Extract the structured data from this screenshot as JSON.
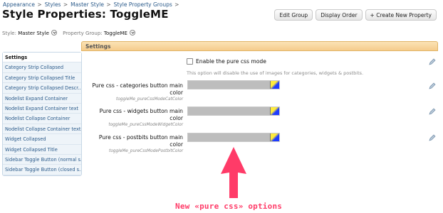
{
  "breadcrumb": [
    "Appearance",
    "Styles",
    "Master Style",
    "Style Property Groups"
  ],
  "page_title": "Style Properties: ToggleME",
  "buttons": {
    "edit_group": "Edit Group",
    "display_order": "Display Order",
    "create": "+ Create New Property"
  },
  "filters": {
    "style_label": "Style:",
    "style_value": "Master Style",
    "group_label": "Property Group:",
    "group_value": "ToggleME"
  },
  "sidebar": {
    "items": [
      {
        "label": "Settings"
      },
      {
        "label": "Category Strip Collapsed"
      },
      {
        "label": "Category Strip Collapsed Title"
      },
      {
        "label": "Category Strip Collapsed Descr..."
      },
      {
        "label": "Nodelist Expand Container"
      },
      {
        "label": "Nodelist Expand Container text"
      },
      {
        "label": "Nodelist Collapse Container"
      },
      {
        "label": "Nodelist Collapse Container text"
      },
      {
        "label": "Widget Collapsed"
      },
      {
        "label": "Widget Collapsed Title"
      },
      {
        "label": "Sidebar Toggle Button (normal s..."
      },
      {
        "label": "Sidebar Toggle Button (closed s..."
      }
    ]
  },
  "settings": {
    "header": "Settings",
    "checkbox_label": "Enable the pure css mode",
    "checkbox_desc": "This option will disable the use of images for categories, widgets & postbits.",
    "properties": [
      {
        "label": "Pure css - categories button main color",
        "key": "toggleMe_pureCssModeCatColor"
      },
      {
        "label": "Pure css - widgets button main color",
        "key": "toggleMe_pureCssModeWidgetColor"
      },
      {
        "label": "Pure css - postbits button main color",
        "key": "toggleMe_pureCssModePostbitColor"
      }
    ]
  },
  "annotation": {
    "text": "New «pure css» options"
  },
  "colors": {
    "link": "#2a5a8a",
    "header": "#f5cc8c",
    "annotation": "#ff3b68",
    "input": "#bdbdbd"
  },
  "icons": {
    "edit": "pencil-icon",
    "dropdown": "chevron-down-icon",
    "arrow": "arrow-up-icon"
  }
}
